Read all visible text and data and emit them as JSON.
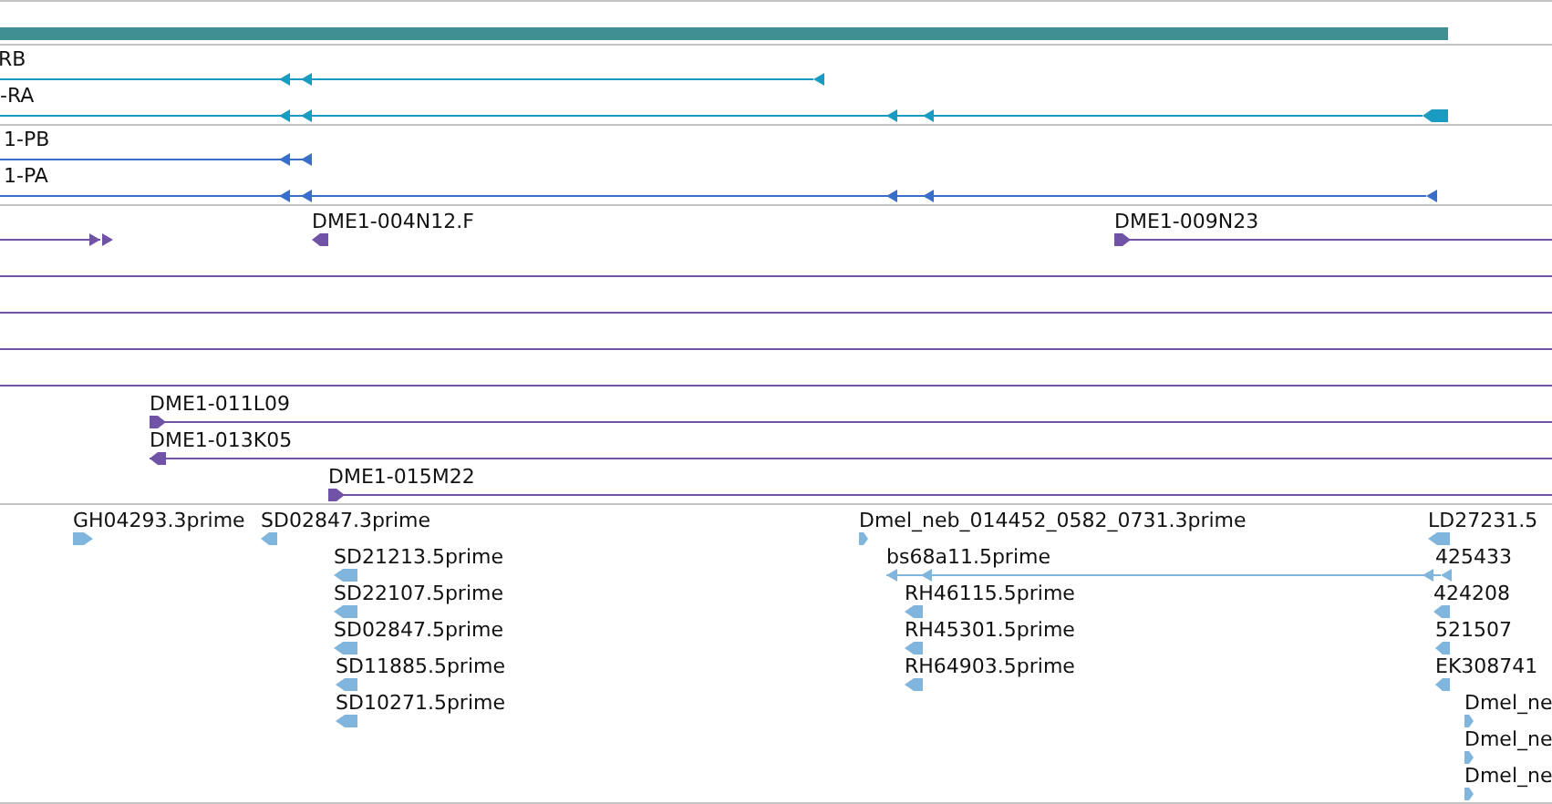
{
  "tracks": [
    {
      "kind": "gene",
      "color": "#3f8f93"
    },
    {
      "kind": "transcript",
      "color": "#1a9bc2",
      "features": [
        {
          "label": "RB",
          "kind": "reverse"
        },
        {
          "label": "-RA",
          "kind": "reverse"
        }
      ]
    },
    {
      "kind": "protein",
      "color": "#3a6fc9",
      "features": [
        {
          "label": "1-PB",
          "kind": "reverse"
        },
        {
          "label": "1-PA",
          "kind": "reverse"
        }
      ]
    },
    {
      "kind": "clone",
      "color": "#7052a6",
      "features": [
        {
          "kind": "forward"
        },
        {
          "label": "DME1-004N12.F",
          "kind": "reverse"
        },
        {
          "label": "DME1-009N23",
          "kind": "forward"
        },
        {
          "kind": "span"
        },
        {
          "kind": "span"
        },
        {
          "kind": "span"
        },
        {
          "kind": "span"
        },
        {
          "label": "DME1-011L09",
          "kind": "forward"
        },
        {
          "label": "DME1-013K05",
          "kind": "reverse"
        },
        {
          "label": "DME1-015M22",
          "kind": "forward"
        }
      ]
    },
    {
      "kind": "est",
      "color": "#80b5dd",
      "features": [
        {
          "label": "GH04293.3prime",
          "kind": "forward"
        },
        {
          "label": "SD02847.3prime",
          "kind": "reverse"
        },
        {
          "label": "Dmel_neb_014452_0582_0731.3prime",
          "kind": "forward"
        },
        {
          "label": "LD27231.5",
          "kind": "reverse"
        },
        {
          "label": "SD21213.5prime",
          "kind": "reverse"
        },
        {
          "label": "bs68a11.5prime",
          "kind": "reverse"
        },
        {
          "label": "425433"
        },
        {
          "label": "SD22107.5prime",
          "kind": "reverse"
        },
        {
          "label": "RH46115.5prime",
          "kind": "reverse"
        },
        {
          "label": "424208",
          "kind": "reverse"
        },
        {
          "label": "SD02847.5prime",
          "kind": "reverse"
        },
        {
          "label": "RH45301.5prime",
          "kind": "reverse"
        },
        {
          "label": "521507",
          "kind": "reverse"
        },
        {
          "label": "SD11885.5prime",
          "kind": "reverse"
        },
        {
          "label": "RH64903.5prime",
          "kind": "reverse"
        },
        {
          "label": "EK308741",
          "kind": "reverse"
        },
        {
          "label": "SD10271.5prime",
          "kind": "reverse"
        },
        {
          "label": "Dmel_ne",
          "kind": "forward"
        },
        {
          "label": "Dmel_ne",
          "kind": "forward"
        },
        {
          "label": "Dmel_ne",
          "kind": "forward"
        }
      ]
    }
  ]
}
